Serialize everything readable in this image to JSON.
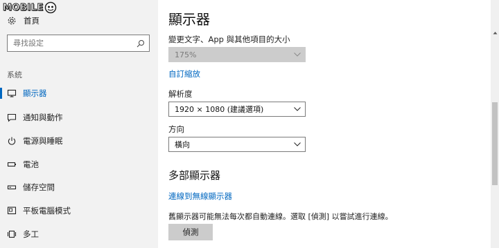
{
  "watermark": {
    "text": "MOBILE"
  },
  "sidebar": {
    "home_label": "首頁",
    "search_placeholder": "尋找設定",
    "section_label": "系統",
    "items": [
      {
        "label": "顯示器",
        "icon": "monitor-icon",
        "active": true
      },
      {
        "label": "通知與動作",
        "icon": "notification-icon"
      },
      {
        "label": "電源與睡眠",
        "icon": "power-icon"
      },
      {
        "label": "電池",
        "icon": "battery-icon"
      },
      {
        "label": "儲存空間",
        "icon": "storage-icon"
      },
      {
        "label": "平板電腦模式",
        "icon": "tablet-mode-icon"
      },
      {
        "label": "多工",
        "icon": "multitasking-icon"
      }
    ]
  },
  "main": {
    "title": "顯示器",
    "scale_label": "變更文字、App 與其他項目的大小",
    "scale_value": "175%",
    "custom_scaling_link": "自訂縮放",
    "resolution_label": "解析度",
    "resolution_value": "1920 × 1080 (建議選項)",
    "orientation_label": "方向",
    "orientation_value": "橫向",
    "multi_display_title": "多部顯示器",
    "wireless_link": "連線到無線顯示器",
    "detect_desc": "舊顯示器可能無法每次都自動連線。選取 [偵測] 以嘗試進行連線。",
    "detect_button": "偵測"
  },
  "colors": {
    "accent": "#0067c0",
    "sidebar_bg": "#f2f2f2",
    "button_bg": "#cccccc"
  }
}
